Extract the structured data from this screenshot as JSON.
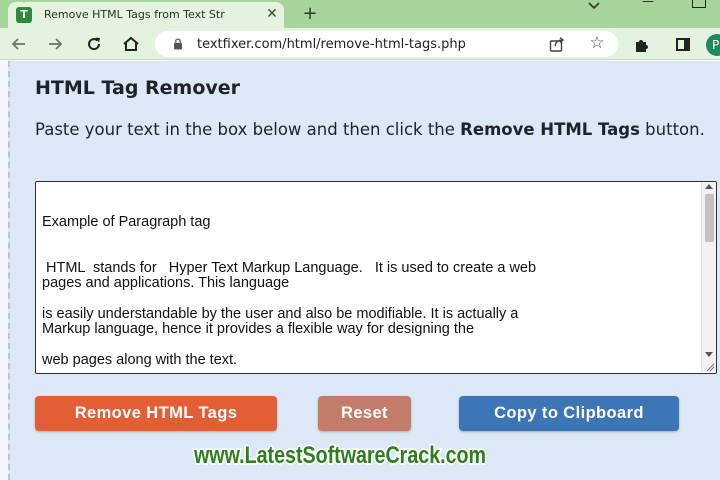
{
  "browser": {
    "tab": {
      "title": "Remove HTML Tags from Text Str",
      "favicon_letter": "T",
      "close_glyph": "✕"
    },
    "new_tab_glyph": "+",
    "url": "textfixer.com/html/remove-html-tags.php",
    "profile_initial": "P"
  },
  "page": {
    "heading": "HTML Tag Remover",
    "instructions_prefix": "Paste your text in the box below and then click the ",
    "instructions_bold": "Remove HTML Tags",
    "instructions_suffix": " button.",
    "textarea_lines": [
      "Example of Paragraph tag",
      " HTML  stands for   Hyper Text Markup Language.   It is used to create a web",
      "pages and applications. This language",
      "is easily understandable by the user and also be modifiable. It is actually a",
      "Markup language, hence it provides a flexible way for designing the",
      "web pages along with the text."
    ],
    "buttons": {
      "remove": "Remove HTML Tags",
      "reset": "Reset",
      "copy": "Copy to Clipboard"
    }
  },
  "watermark": {
    "text": "www.LatestSoftwareCrack.com"
  },
  "colors": {
    "tabstrip": "#a7d49a",
    "toolbar": "#e4f3df",
    "card_bg": "#dce8f5",
    "remove_button": "#e35e35",
    "reset_button": "#c47c6a",
    "copy_button": "#3d76b6",
    "watermark_fill": "#2e7d1f"
  },
  "icons": {
    "back": "arrow-left-icon",
    "forward": "arrow-right-icon",
    "reload": "reload-icon",
    "home": "home-icon",
    "lock": "lock-icon",
    "share": "share-icon",
    "bookmark": "star-icon",
    "extensions": "puzzle-icon",
    "side_panel": "side-panel-icon"
  }
}
